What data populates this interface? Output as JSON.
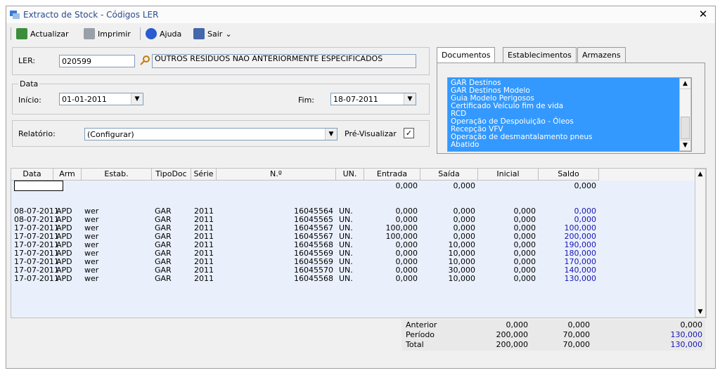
{
  "window": {
    "title": "Extracto de Stock  - Códigos LER",
    "close_label": "✕"
  },
  "toolbar": {
    "actualizar": "Actualizar",
    "imprimir": "Imprimir",
    "ajuda": "Ajuda",
    "sair": "Sair",
    "sair_dropdown": "⌄"
  },
  "ler": {
    "label": "LER:",
    "code": "020599",
    "description": "OUTROS RESÍDUOS NÃO ANTERIORMENTE ESPECIFICADOS"
  },
  "data_group": {
    "label": "Data",
    "inicio_label": "Início:",
    "inicio_value": "01-01-2011",
    "fim_label": "Fim:",
    "fim_value": "18-07-2011"
  },
  "relatorio": {
    "label": "Relatório:",
    "value": "(Configurar)",
    "preview_label": "Pré-Visualizar",
    "preview_checked": true
  },
  "tabs": [
    {
      "label": "Documentos"
    },
    {
      "label": "Establecimentos"
    },
    {
      "label": "Armazens"
    }
  ],
  "documentos": [
    "GAR Destinos",
    "GAR Destinos Modelo",
    "Guia Modelo Perigosos",
    "Certificado Veículo fim de vida",
    "RCD",
    "Operação de Despoluição - Óleos",
    "Recepção VFV",
    "Operação de desmantalamento pneus",
    "Abatido"
  ],
  "grid": {
    "headers": [
      "Data",
      "Arm",
      "Estab.",
      "TipoDoc",
      "Série",
      "N.º",
      "UN.",
      "Entrada",
      "Saída",
      "Inicial",
      "Saldo"
    ],
    "initial_row": {
      "entrada": "0,000",
      "saida": "0,000",
      "saldo": "0,000"
    },
    "rows": [
      {
        "data": "08-07-2011",
        "arm": "APD",
        "estab": "wer",
        "tipo": "GAR",
        "serie": "2011",
        "num": "16045564",
        "un": "UN.",
        "entrada": "0,000",
        "saida": "0,000",
        "inicial": "0,000",
        "saldo": "0,000"
      },
      {
        "data": "08-07-2011",
        "arm": "APD",
        "estab": "wer",
        "tipo": "GAR",
        "serie": "2011",
        "num": "16045565",
        "un": "UN.",
        "entrada": "0,000",
        "saida": "0,000",
        "inicial": "0,000",
        "saldo": "0,000"
      },
      {
        "data": "17-07-2011",
        "arm": "APD",
        "estab": "wer",
        "tipo": "GAR",
        "serie": "2011",
        "num": "16045567",
        "un": "UN.",
        "entrada": "100,000",
        "saida": "0,000",
        "inicial": "0,000",
        "saldo": "100,000"
      },
      {
        "data": "17-07-2011",
        "arm": "APD",
        "estab": "wer",
        "tipo": "GAR",
        "serie": "2011",
        "num": "16045567",
        "un": "UN.",
        "entrada": "100,000",
        "saida": "0,000",
        "inicial": "0,000",
        "saldo": "200,000"
      },
      {
        "data": "17-07-2011",
        "arm": "APD",
        "estab": "wer",
        "tipo": "GAR",
        "serie": "2011",
        "num": "16045568",
        "un": "UN.",
        "entrada": "0,000",
        "saida": "10,000",
        "inicial": "0,000",
        "saldo": "190,000"
      },
      {
        "data": "17-07-2011",
        "arm": "APD",
        "estab": "wer",
        "tipo": "GAR",
        "serie": "2011",
        "num": "16045569",
        "un": "UN.",
        "entrada": "0,000",
        "saida": "10,000",
        "inicial": "0,000",
        "saldo": "180,000"
      },
      {
        "data": "17-07-2011",
        "arm": "APD",
        "estab": "wer",
        "tipo": "GAR",
        "serie": "2011",
        "num": "16045569",
        "un": "UN.",
        "entrada": "0,000",
        "saida": "10,000",
        "inicial": "0,000",
        "saldo": "170,000"
      },
      {
        "data": "17-07-2011",
        "arm": "APD",
        "estab": "wer",
        "tipo": "GAR",
        "serie": "2011",
        "num": "16045570",
        "un": "UN.",
        "entrada": "0,000",
        "saida": "30,000",
        "inicial": "0,000",
        "saldo": "140,000"
      },
      {
        "data": "17-07-2011",
        "arm": "APD",
        "estab": "wer",
        "tipo": "GAR",
        "serie": "2011",
        "num": "16045568",
        "un": "UN.",
        "entrada": "0,000",
        "saida": "10,000",
        "inicial": "0,000",
        "saldo": "130,000"
      }
    ]
  },
  "totals": [
    {
      "label": "Anterior",
      "a": "0,000",
      "b": "0,000",
      "c": "0,000"
    },
    {
      "label": "Período",
      "a": "200,000",
      "b": "70,000",
      "c": "130,000"
    },
    {
      "label": "Total",
      "a": "200,000",
      "b": "70,000",
      "c": "130,000"
    }
  ],
  "colors": {
    "selection": "#3399ff",
    "saldo": "#1414b4",
    "title": "#2a4c8c"
  }
}
